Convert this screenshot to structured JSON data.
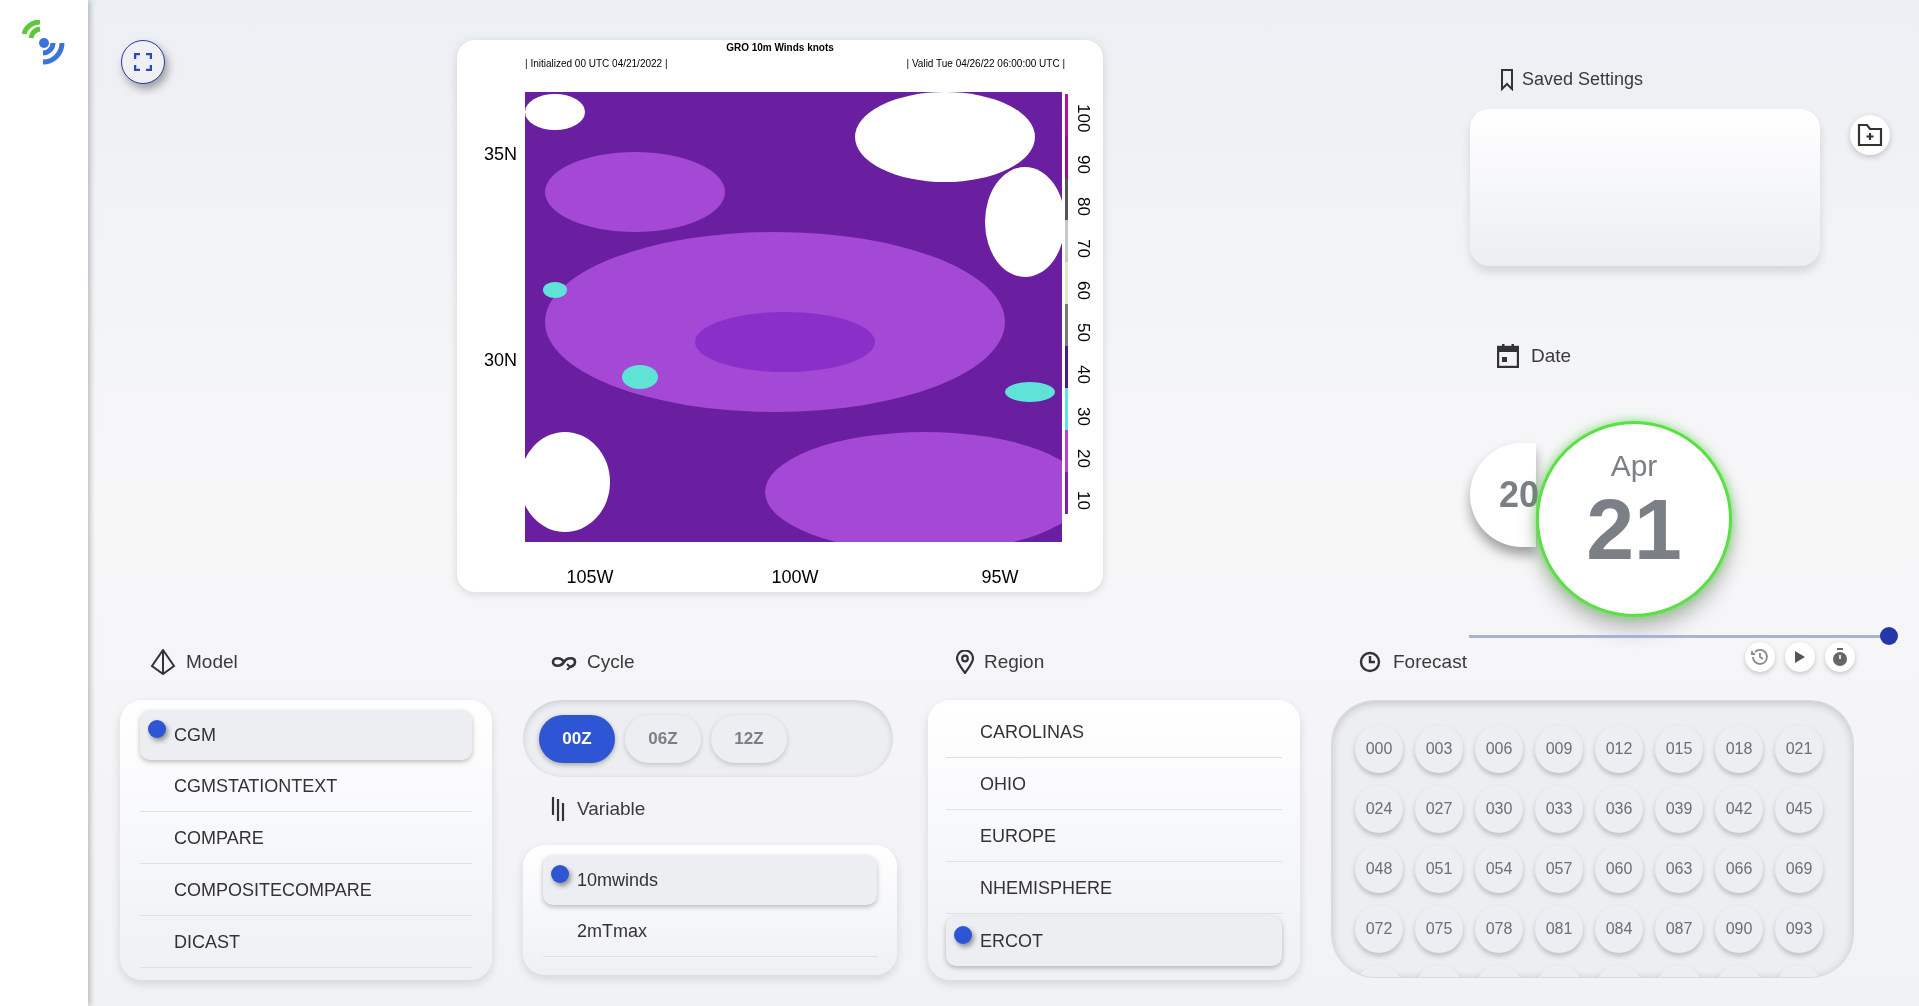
{
  "map": {
    "title": "GRO 10m Winds knots",
    "initialized": "| Initialized 00 UTC 04/21/2022 |",
    "valid": "| Valid Tue 04/26/22 06:00:00 UTC |",
    "lat_labels": [
      "35N",
      "30N"
    ],
    "lon_labels": [
      "105W",
      "100W",
      "95W"
    ],
    "colorbar_labels": [
      "100",
      "90",
      "80",
      "70",
      "60",
      "50",
      "40",
      "30",
      "20",
      "10"
    ]
  },
  "saved_settings": {
    "label": "Saved Settings"
  },
  "date": {
    "label": "Date",
    "previous_day": "20",
    "month": "Apr",
    "day": "21"
  },
  "model": {
    "label": "Model",
    "items": [
      {
        "label": "CGM",
        "selected": true
      },
      {
        "label": "CGMSTATIONTEXT",
        "selected": false
      },
      {
        "label": "COMPARE",
        "selected": false
      },
      {
        "label": "COMPOSITECOMPARE",
        "selected": false
      },
      {
        "label": "DICAST",
        "selected": false
      }
    ]
  },
  "cycle": {
    "label": "Cycle",
    "options": [
      {
        "label": "00Z",
        "selected": true
      },
      {
        "label": "06Z",
        "selected": false
      },
      {
        "label": "12Z",
        "selected": false
      }
    ]
  },
  "variable": {
    "label": "Variable",
    "items": [
      {
        "label": "10mwinds",
        "selected": true
      },
      {
        "label": "2mTmax",
        "selected": false
      }
    ]
  },
  "region": {
    "label": "Region",
    "items": [
      {
        "label": "CAROLINAS",
        "selected": false
      },
      {
        "label": "OHIO",
        "selected": false
      },
      {
        "label": "EUROPE",
        "selected": false
      },
      {
        "label": "NHEMISPHERE",
        "selected": false
      },
      {
        "label": "ERCOT",
        "selected": true
      }
    ]
  },
  "forecast": {
    "label": "Forecast",
    "slider": {
      "level": 1
    },
    "hours": [
      "000",
      "003",
      "006",
      "009",
      "012",
      "015",
      "018",
      "021",
      "024",
      "027",
      "030",
      "033",
      "036",
      "039",
      "042",
      "045",
      "048",
      "051",
      "054",
      "057",
      "060",
      "063",
      "066",
      "069",
      "072",
      "075",
      "078",
      "081",
      "084",
      "087",
      "090",
      "093"
    ]
  }
}
